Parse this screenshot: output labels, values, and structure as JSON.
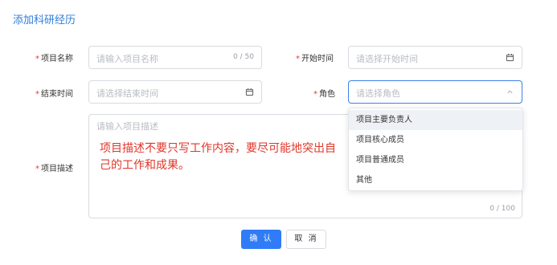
{
  "form": {
    "title": "添加科研经历",
    "required_mark": "*",
    "project_name": {
      "label": "项目名称",
      "placeholder": "请输入项目名称",
      "counter": "0 / 50"
    },
    "start_time": {
      "label": "开始时间",
      "placeholder": "请选择开始时间"
    },
    "end_time": {
      "label": "结束时间",
      "placeholder": "请选择结束时间"
    },
    "role": {
      "label": "角色",
      "placeholder": "请选择角色",
      "options": [
        "项目主要负责人",
        "项目核心成员",
        "项目普通成员",
        "其他"
      ]
    },
    "description": {
      "label": "项目描述",
      "placeholder": "请输入项目描述",
      "counter": "0 / 100"
    },
    "overlay_note": "项目描述不要只写工作内容，要尽可能地突出自己的工作和成果。"
  },
  "buttons": {
    "confirm": "确 认",
    "cancel": "取 消"
  },
  "colors": {
    "accent": "#2f7cf6",
    "required": "#e5393b",
    "overlay_text": "#e0362b"
  }
}
